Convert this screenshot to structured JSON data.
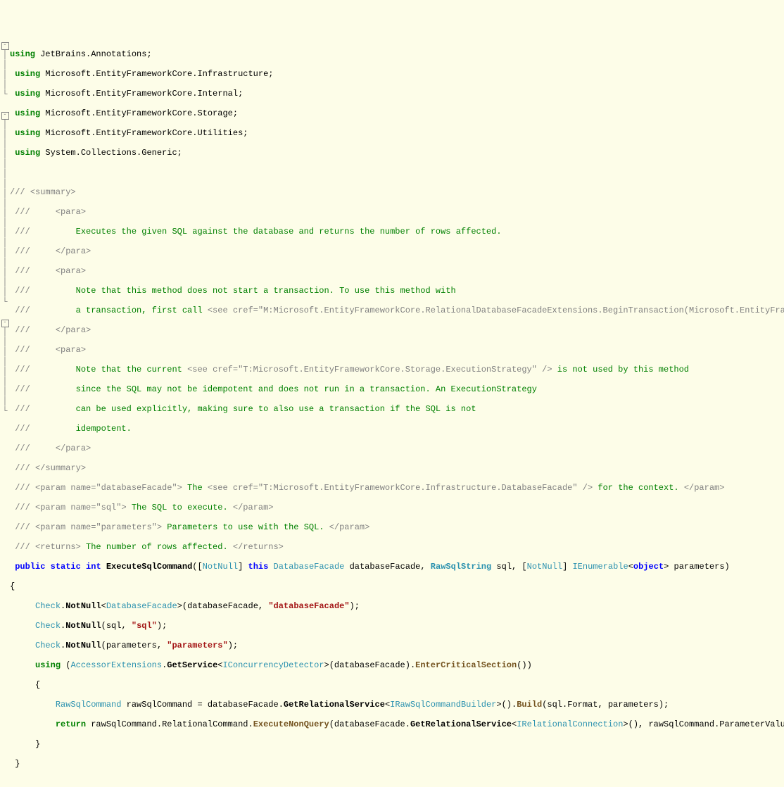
{
  "usings": {
    "u1": "JetBrains.Annotations;",
    "u2": "Microsoft.EntityFrameworkCore.Infrastructure;",
    "u3": "Microsoft.EntityFrameworkCore.Internal;",
    "u4": "Microsoft.EntityFrameworkCore.Storage;",
    "u5": "Microsoft.EntityFrameworkCore.Utilities;",
    "u6": "System.Collections.Generic;"
  },
  "doc": {
    "summary_open": "<summary>",
    "summary_close": "</summary>",
    "para_open": "<para>",
    "para_close": "</para>",
    "line1": "Executes the given SQL against the database and returns the number of rows affected.",
    "line2a": "Note that this method does not start a transaction. To use this method with",
    "line2b_a": "a transaction, first call ",
    "see_open1": "<see cref=",
    "cref1": "\"M:Microsoft.EntityFrameworkCore.RelationalDatabaseFacadeExtensions.BeginTransaction(Microsoft.EntityFrameworkCore",
    "line3a_a": "Note that the current ",
    "see_open2": "<see cref=",
    "cref2": "\"T:Microsoft.EntityFrameworkCore.Storage.ExecutionStrategy\"",
    "see_close_self": " />",
    "line3a_b": " is not used by this method",
    "line3b": "since the SQL may not be idempotent and does not run in a transaction. An ExecutionStrategy",
    "line3c": "can be used explicitly, making sure to also use a transaction if the SQL is not",
    "line3d": "idempotent.",
    "param_open": "<param name=",
    "p1_name": "\"databaseFacade\"",
    "p1_txt_a": " The ",
    "p1_see": "<see cref=",
    "p1_cref": "\"T:Microsoft.EntityFrameworkCore.Infrastructure.DatabaseFacade\"",
    "p1_txt_b": " for the context. ",
    "param_close": "</param>",
    "p2_name": "\"sql\"",
    "p2_txt": " The SQL to execute. ",
    "p3_name": "\"parameters\"",
    "p3_txt": " Parameters to use with the SQL. ",
    "returns_open": "<returns>",
    "returns_txt": " The number of rows affected. ",
    "returns_close": "</returns>",
    "gt": ">"
  },
  "sig": {
    "public": "public",
    "static": "static",
    "int": "int",
    "name": "ExecuteSqlCommand",
    "notnull": "NotNull",
    "this": "this",
    "dbfacade_t": "DatabaseFacade",
    "dbfacade_p": "databaseFacade",
    "rawstr_t": "RawSqlString",
    "sql_p": "sql",
    "ienum_t": "IEnumerable",
    "obj_t": "object",
    "params_p": "parameters"
  },
  "body": {
    "check": "Check",
    "notnull": "NotNull",
    "dbfacade_t": "DatabaseFacade",
    "dbfacade_arg": "databaseFacade",
    "dbfacade_str": "\"databaseFacade\"",
    "sql_arg": "sql",
    "sql_str": "\"sql\"",
    "params_arg": "parameters",
    "params_str": "\"parameters\"",
    "using": "using",
    "accext": "AccessorExtensions",
    "getsvc": "GetService",
    "iconc": "IConcurrencyDetector",
    "entercrit": "EnterCriticalSection",
    "rawcmd_t": "RawSqlCommand",
    "rawcmd_v": "rawSqlCommand",
    "getrel": "GetRelationalService",
    "irawbuilder": "IRawSqlCommandBuilder",
    "build": "Build",
    "format": "Format",
    "return": "return",
    "relcmd": "RelationalCommand",
    "execnq": "ExecuteNonQuery",
    "irelconn": "IRelationalConnection",
    "paramvals": "ParameterValues"
  }
}
